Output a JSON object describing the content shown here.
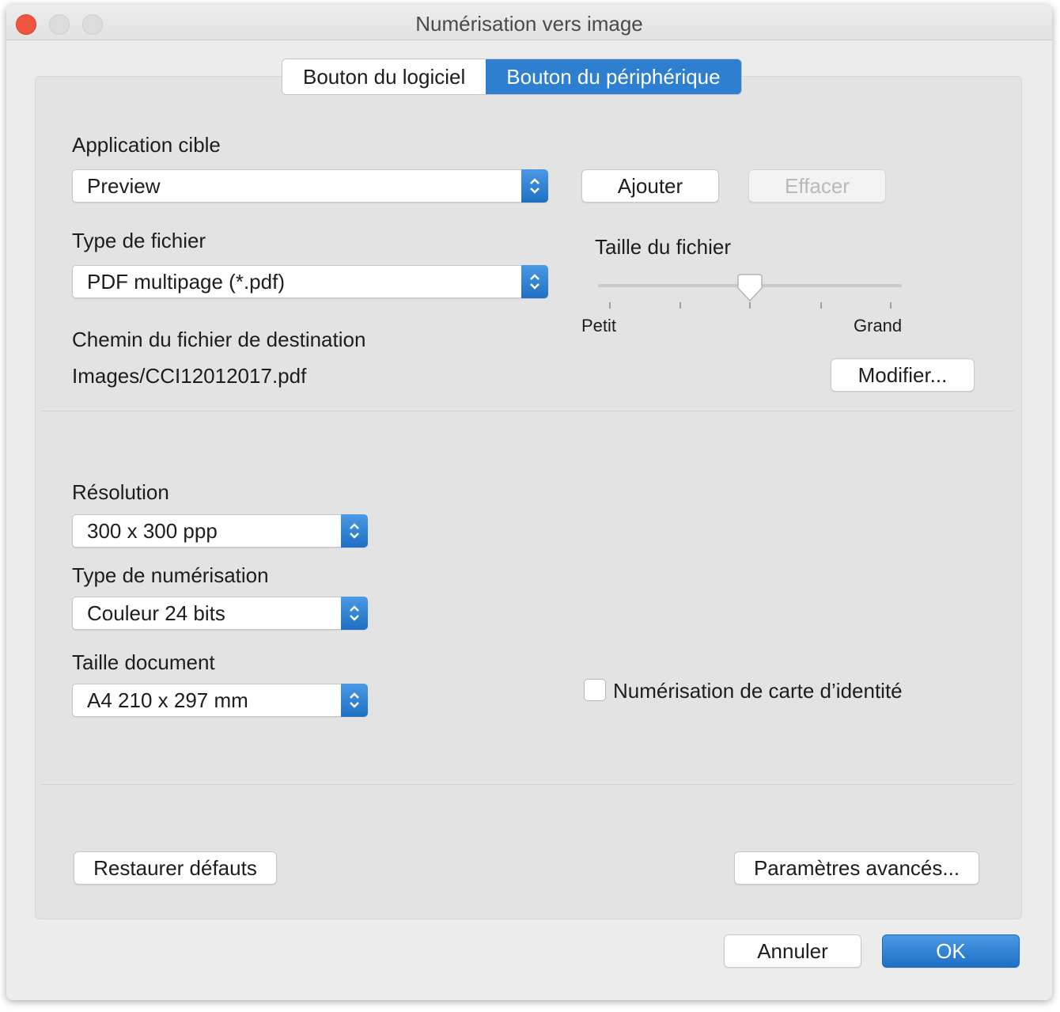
{
  "window": {
    "title": "Numérisation vers image"
  },
  "tabs": [
    {
      "label": "Bouton du logiciel",
      "active": false
    },
    {
      "label": "Bouton du périphérique",
      "active": true
    }
  ],
  "target_app": {
    "label": "Application cible",
    "value": "Preview",
    "add_button": "Ajouter",
    "delete_button": "Effacer"
  },
  "file_type": {
    "label": "Type de fichier",
    "value": "PDF multipage (*.pdf)"
  },
  "file_size": {
    "label": "Taille du fichier",
    "min_label": "Petit",
    "max_label": "Grand",
    "level": 0.5
  },
  "destination": {
    "label": "Chemin du fichier de destination",
    "path": "Images/CCI12012017.pdf",
    "modify_button": "Modifier..."
  },
  "resolution": {
    "label": "Résolution",
    "value": "300 x 300 ppp"
  },
  "scan_type": {
    "label": "Type de numérisation",
    "value": "Couleur 24 bits"
  },
  "document_size": {
    "label": "Taille document",
    "value": "A4 210 x 297 mm"
  },
  "id_card": {
    "label": "Numérisation de carte d’identité",
    "checked": false
  },
  "footer": {
    "restore_button": "Restaurer défauts",
    "advanced_button": "Paramètres avancés...",
    "cancel_button": "Annuler",
    "ok_button": "OK"
  },
  "colors": {
    "accent": "#2f7fd0",
    "close": "#f0553f"
  },
  "icons": [
    "close-dot-icon",
    "minimize-dot-icon",
    "zoom-dot-icon",
    "select-stepper-icon",
    "slider-thumb-icon"
  ]
}
